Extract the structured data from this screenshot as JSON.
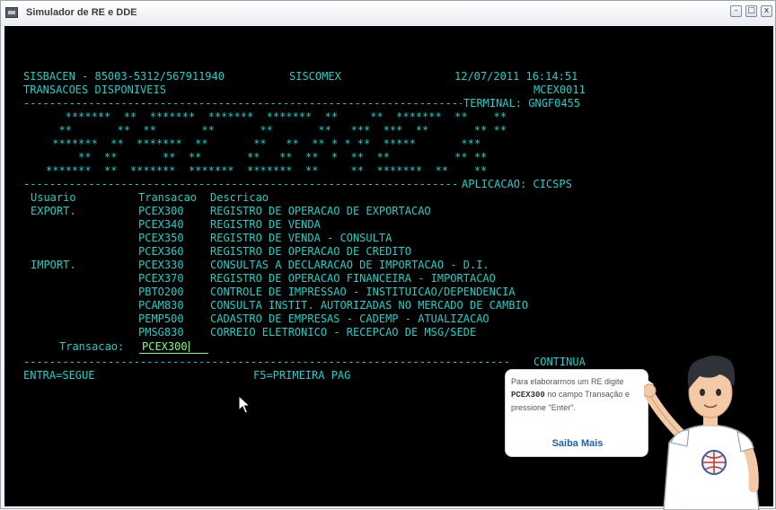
{
  "window": {
    "title": "Simulador de RE e DDE",
    "minimize_glyph": "–",
    "maximize_glyph": "□",
    "close_glyph": "x"
  },
  "terminal": {
    "header_left": "SISBACEN - 85003-5312/567911940",
    "header_center": "SISCOMEX",
    "header_datetime": "12/07/2011 16:14:51",
    "subtitle": "TRANSACOES DISPONIVEIS",
    "screen_code": "MCEX0011",
    "terminal_label": "TERMINAL: GNGF0455",
    "banner_lines": [
      "   *******  **  *******  *******  *******  **     **  *******  **    **",
      "  **       **  **       **       **       **   ***  ***  **       ** **",
      " *******  **  *******  **       **   **  ** * * **  *****       ***",
      "     **  **       **  **       **   **  **  *  **  **          ** **",
      "*******  **  *******  *******  *******  **     **  *******  **    **"
    ],
    "application_label": "APLICACAO: CICSPS",
    "col_usuario": "Usuario",
    "col_transacao": "Transacao",
    "col_descricao": "Descricao",
    "rows": [
      {
        "usuario": "EXPORT.",
        "code": "PCEX300",
        "desc": "REGISTRO DE OPERACAO DE EXPORTACAO"
      },
      {
        "usuario": "",
        "code": "PCEX340",
        "desc": "REGISTRO DE VENDA"
      },
      {
        "usuario": "",
        "code": "PCEX350",
        "desc": "REGISTRO DE VENDA - CONSULTA"
      },
      {
        "usuario": "",
        "code": "PCEX360",
        "desc": "REGISTRO DE OPERACAO DE CREDITO"
      },
      {
        "usuario": "IMPORT.",
        "code": "PCEX330",
        "desc": "CONSULTAS A DECLARACAO DE IMPORTACAO - D.I."
      },
      {
        "usuario": "",
        "code": "PCEX370",
        "desc": "REGISTRO DE OPERACAO FINANCEIRA - IMPORTACAO"
      },
      {
        "usuario": "",
        "code": "PBTO200",
        "desc": "CONTROLE DE IMPRESSAO - INSTITUICAO/DEPENDENCIA"
      },
      {
        "usuario": "",
        "code": "PCAM830",
        "desc": "CONSULTA INSTIT. AUTORIZADAS NO MERCADO DE CAMBIO"
      },
      {
        "usuario": "",
        "code": "PEMP500",
        "desc": "CADASTRO DE EMPRESAS - CADEMP - ATUALIZACAO"
      },
      {
        "usuario": "",
        "code": "PMSG830",
        "desc": "CORREIO ELETRONICO - RECEPCAO DE MSG/SEDE"
      }
    ],
    "input_label": "Transacao:",
    "input_value": "PCEX300",
    "continua": "CONTINUA",
    "footer_enter": "ENTRA=SEGUE",
    "footer_f5": "F5=PRIMEIRA PAG"
  },
  "tooltip": {
    "text_before": "Para elaborarmos um RE digite ",
    "text_code": "PCEX300",
    "text_after": " no campo Transação e pressione \"Enter\".",
    "link_label": "Saiba Mais"
  },
  "colors": {
    "terminal_bg": "#000000",
    "terminal_text": "#1fcfc8",
    "input_text": "#7dff7d",
    "link": "#1f5fae"
  },
  "icons": {
    "window_icon": "terminal-window-icon",
    "mouse": "mouse-pointer-icon",
    "mascot": "assistant-character-icon"
  }
}
